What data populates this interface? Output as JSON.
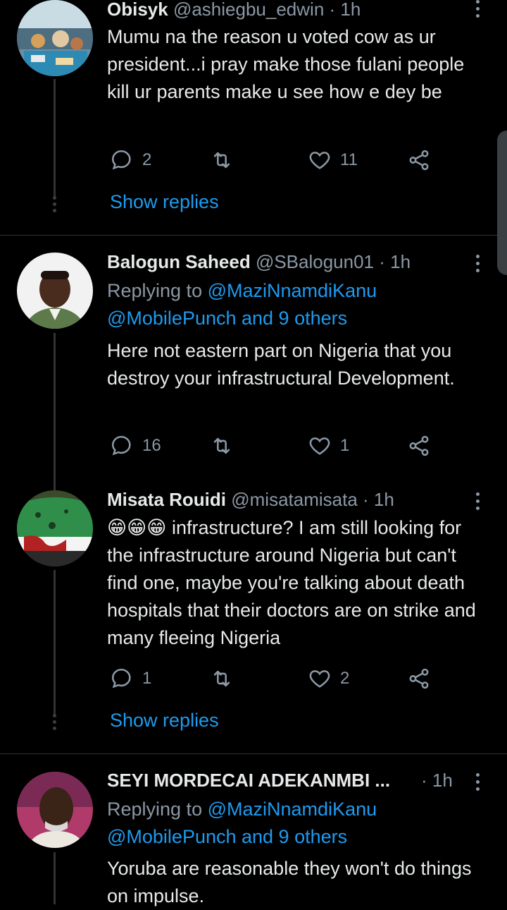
{
  "tweets": [
    {
      "name": "Obisyk",
      "handle": "@ashiegbu_edwin",
      "time": "· 1h",
      "text": "Mumu na the reason u voted cow as ur president...i pray make those fulani people kill ur parents make u see how e dey be",
      "replies": "2",
      "retweets": "",
      "likes": "11",
      "show_replies": "Show replies"
    },
    {
      "name": "Balogun Saheed",
      "handle": "@SBalogun01",
      "time": "· 1h",
      "replying_prefix": "Replying to",
      "replying_users": "@MaziNnamdiKanu @MobilePunch and 9 others",
      "text": "Here not eastern part on Nigeria that you destroy your infrastructural Development.",
      "replies": "16",
      "retweets": "",
      "likes": "1"
    },
    {
      "name": "Misata Rouidi",
      "handle": "@misatamisata",
      "time": "· 1h",
      "emojis": "😁😁😁",
      "text": "infrastructure? I am still looking for the infrastructure around Nigeria but can't find one, maybe you're talking about death hospitals that their doctors are on strike and many fleeing Nigeria",
      "replies": "1",
      "retweets": "",
      "likes": "2",
      "show_replies": "Show replies"
    },
    {
      "name": "SEYI MORDECAI ADEKANMBI ...",
      "handle": "",
      "time": "· 1h",
      "replying_prefix": "Replying to",
      "replying_users": "@MaziNnamdiKanu @MobilePunch and 9 others",
      "text": "Yoruba are reasonable they won't do things on impulse."
    }
  ],
  "icons": {
    "reply": "reply-icon",
    "retweet": "retweet-icon",
    "like": "heart-icon",
    "share": "share-icon",
    "more": "more-vertical-icon"
  },
  "colors": {
    "background": "#000000",
    "link": "#1d9bf0",
    "secondary_text": "#8b98a5"
  }
}
